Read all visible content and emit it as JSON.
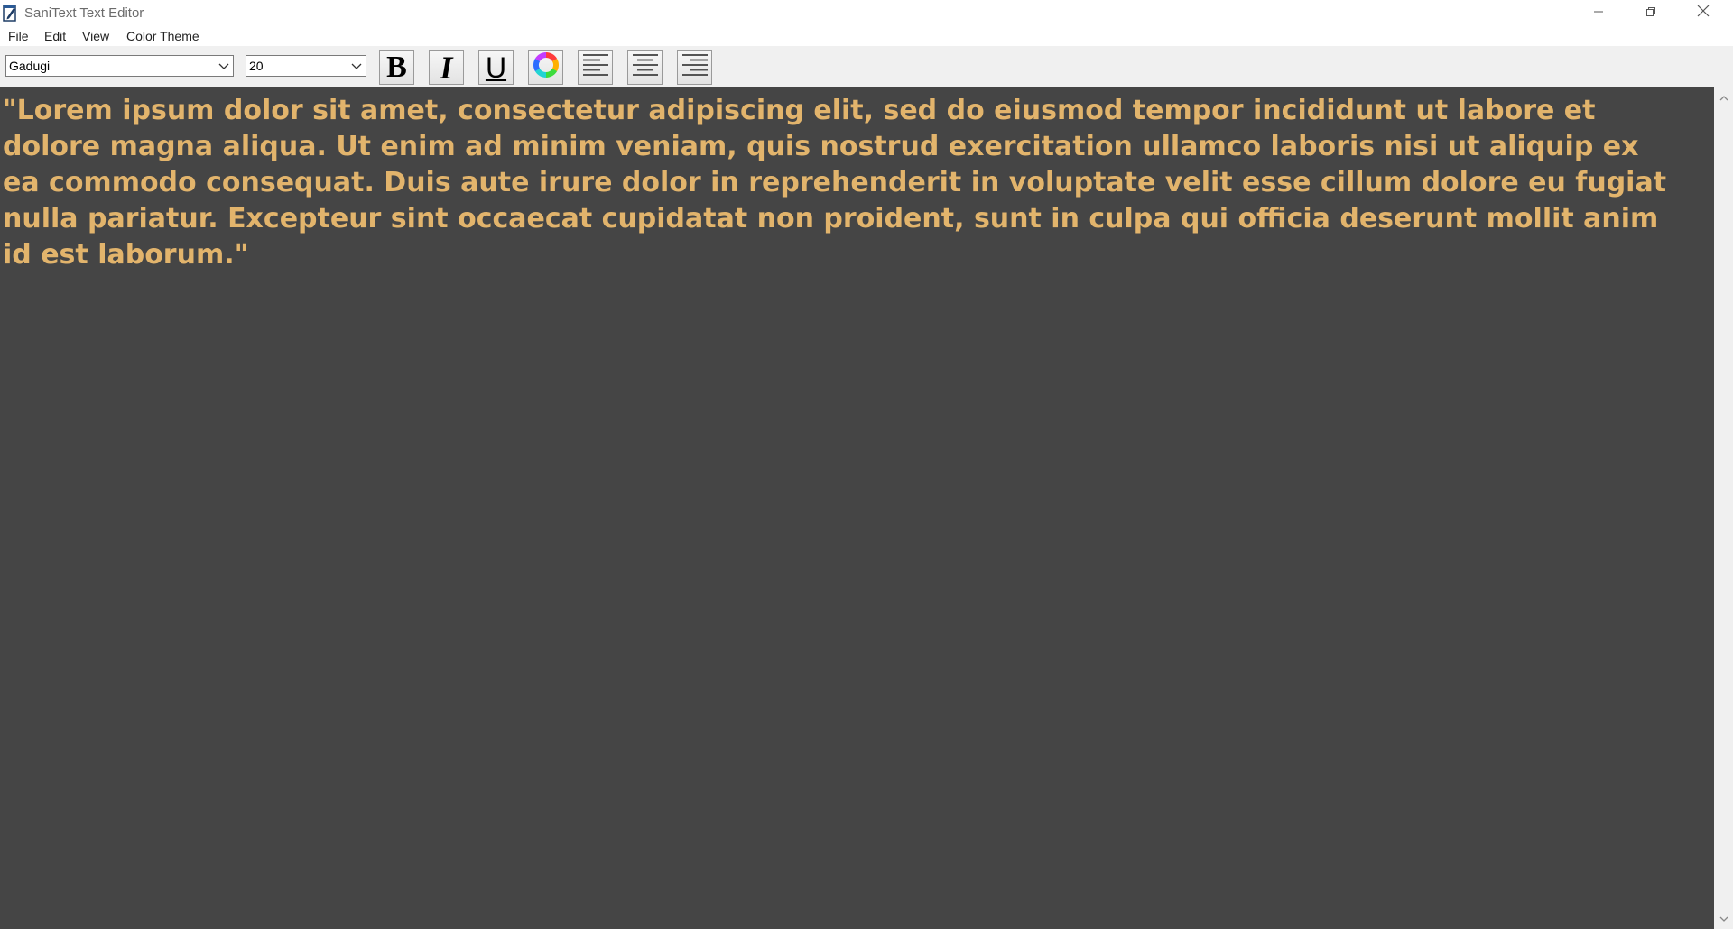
{
  "window": {
    "title": "SaniText Text Editor",
    "icons": {
      "app": "notepad-pen-icon",
      "minimize": "minimize-icon",
      "maximize": "restore-icon",
      "close": "close-icon"
    }
  },
  "menu": {
    "items": [
      {
        "label": "File"
      },
      {
        "label": "Edit"
      },
      {
        "label": "View"
      },
      {
        "label": "Color Theme"
      }
    ]
  },
  "toolbar": {
    "font_family": {
      "value": "Gadugi"
    },
    "font_size": {
      "value": "20"
    },
    "bold_label": "B",
    "italic_label": "I",
    "underline_label": "U",
    "icons": {
      "color": "color-wheel-icon",
      "align_left": "align-left-icon",
      "align_center": "align-center-icon",
      "align_right": "align-right-icon"
    }
  },
  "editor": {
    "content": "\"Lorem ipsum dolor sit amet, consectetur adipiscing elit, sed do eiusmod tempor incididunt ut labore et dolore magna aliqua. Ut enim ad minim veniam, quis nostrud exercitation ullamco laboris nisi ut aliquip ex ea commodo consequat. Duis aute irure dolor in reprehenderit in voluptate velit esse cillum dolore eu fugiat nulla pariatur. Excepteur sint occaecat cupidatat non proident, sunt in culpa qui officia deserunt mollit anim id est laborum.\"",
    "background_color": "#454545",
    "text_color": "#e2b46c"
  }
}
